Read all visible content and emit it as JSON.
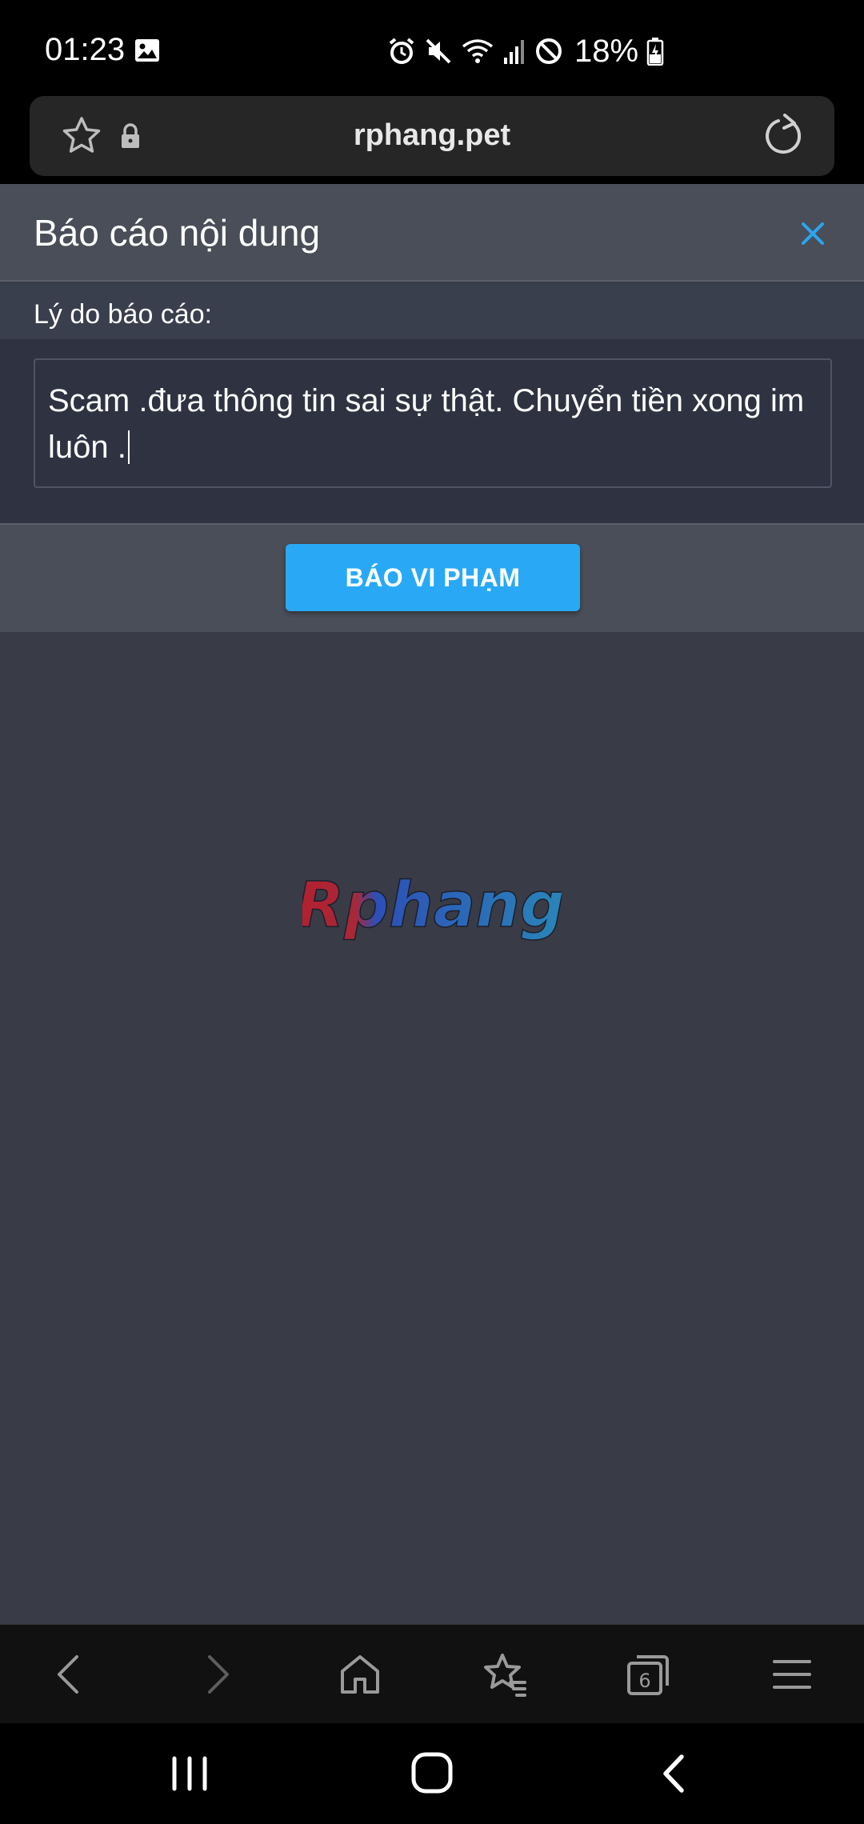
{
  "status_bar": {
    "time": "01:23",
    "battery": "18%",
    "icons": [
      "gallery-icon",
      "alarm-icon",
      "mute-icon",
      "wifi-icon",
      "signal-icon",
      "do-not-disturb-icon",
      "battery-charging-icon"
    ]
  },
  "url_bar": {
    "url": "rphang.pet",
    "icons": [
      "bookmark-star-icon",
      "lock-icon",
      "reload-icon"
    ]
  },
  "modal": {
    "title": "Báo cáo nội dung",
    "reason_label": "Lý do báo cáo:",
    "reason_value": "Scam .đưa thông tin sai sự thật. Chuyển tiền xong im luôn .",
    "submit_label": "BÁO VI PHẠM"
  },
  "logo_text": "Rphang",
  "browser_nav": {
    "tabs_count": "6",
    "items": [
      "back-icon",
      "forward-icon",
      "home-icon",
      "bookmarks-icon",
      "tabs-icon",
      "menu-icon"
    ]
  },
  "system_nav": {
    "items": [
      "recent-apps-icon",
      "home-button-icon",
      "back-button-icon"
    ]
  },
  "colors": {
    "accent": "#29a9f5",
    "page_bg": "#393c46",
    "header_bg": "#4a4e58",
    "field_bg": "#2f3341"
  }
}
